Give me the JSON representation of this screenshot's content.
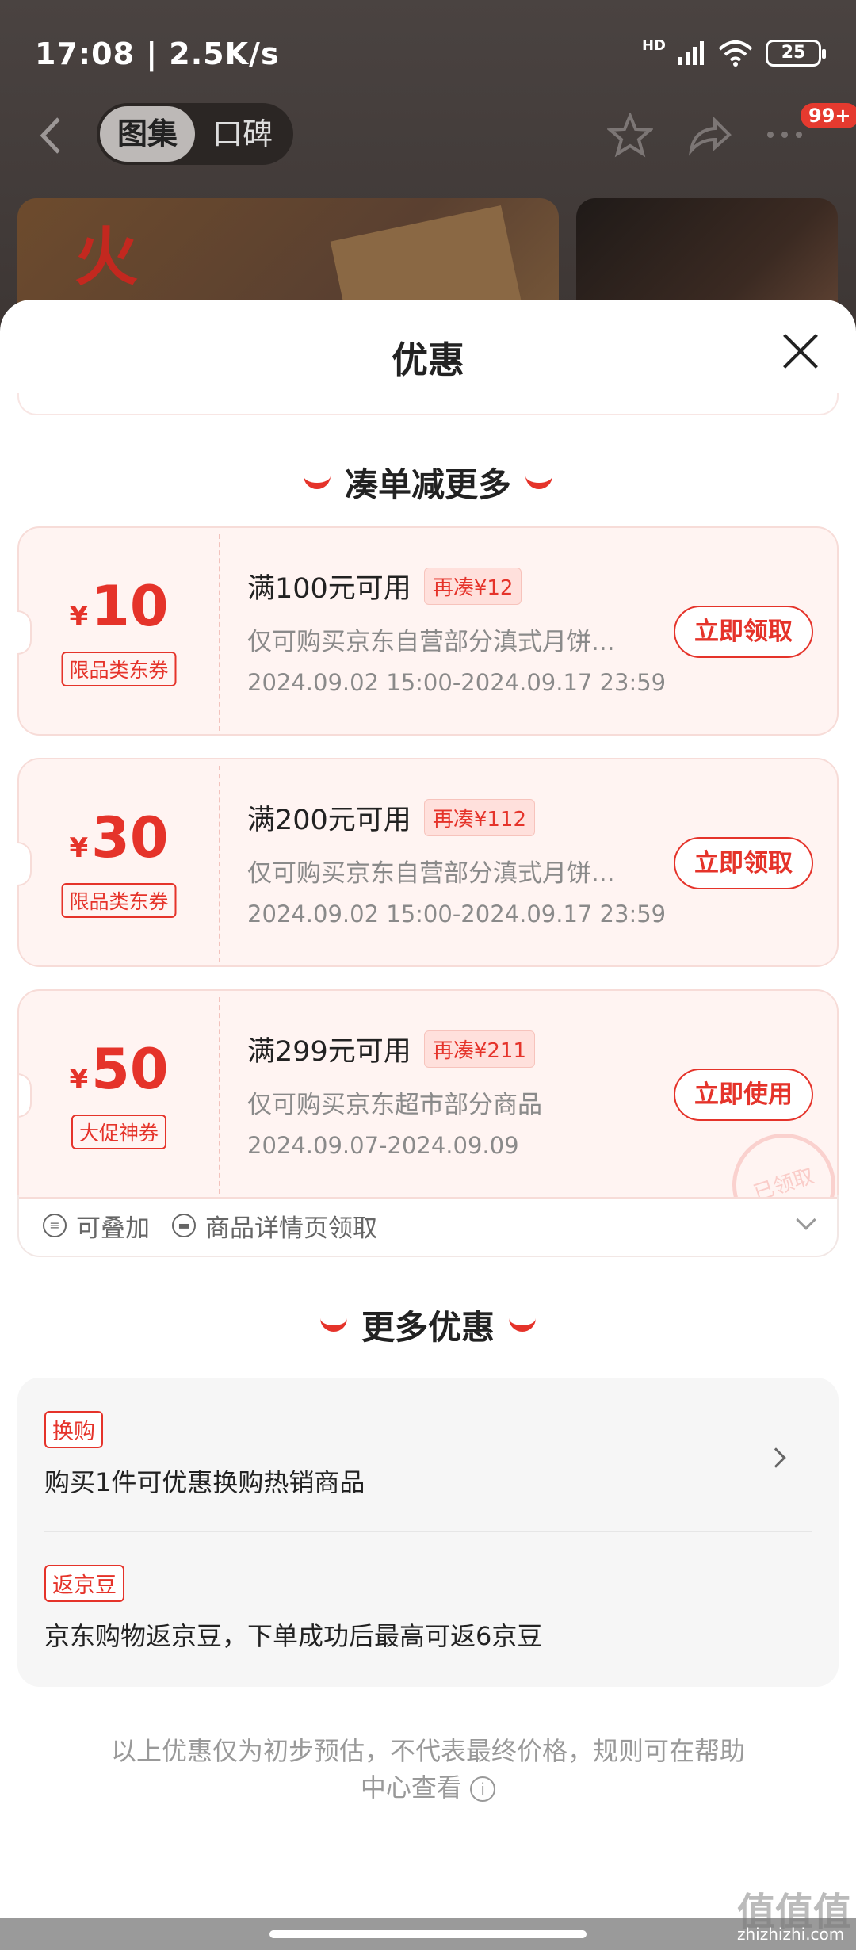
{
  "status": {
    "time": "17:08 | 2.5K/s",
    "hd": "HD",
    "battery": "25"
  },
  "nav": {
    "tabs": [
      "图集",
      "口碑"
    ],
    "badge": "99+"
  },
  "banner": {
    "text": "火"
  },
  "sheet": {
    "title": "优惠"
  },
  "section_combine": {
    "title": "凑单减更多"
  },
  "coupons": [
    {
      "currency": "¥",
      "amount": "10",
      "tag": "限品类东券",
      "condition": "满100元可用",
      "diff": "再凑¥12",
      "desc": "仅可购买京东自营部分滇式月饼...",
      "dates": "2024.09.02 15:00-2024.09.17 23:59",
      "button": "立即领取"
    },
    {
      "currency": "¥",
      "amount": "30",
      "tag": "限品类东券",
      "condition": "满200元可用",
      "diff": "再凑¥112",
      "desc": "仅可购买京东自营部分滇式月饼...",
      "dates": "2024.09.02 15:00-2024.09.17 23:59",
      "button": "立即领取"
    },
    {
      "currency": "¥",
      "amount": "50",
      "tag": "大促神券",
      "condition": "满299元可用",
      "diff": "再凑¥211",
      "desc": "仅可购买京东超市部分商品",
      "dates": "2024.09.07-2024.09.09",
      "button": "立即使用",
      "stamp": "已领取"
    }
  ],
  "coupon_footer": {
    "stackable": "可叠加",
    "source": "商品详情页领取"
  },
  "section_more": {
    "title": "更多优惠"
  },
  "more_items": [
    {
      "tag": "换购",
      "text": "购买1件可优惠换购热销商品"
    },
    {
      "tag": "返京豆",
      "text": "京东购物返京豆，下单成功后最高可返6京豆"
    }
  ],
  "note": {
    "line1": "以上优惠仅为初步预估，不代表最终价格，规则可在帮助",
    "line2": "中心查看"
  },
  "watermark": {
    "main": "值值值",
    "sub": "zhizhizhi.com"
  }
}
